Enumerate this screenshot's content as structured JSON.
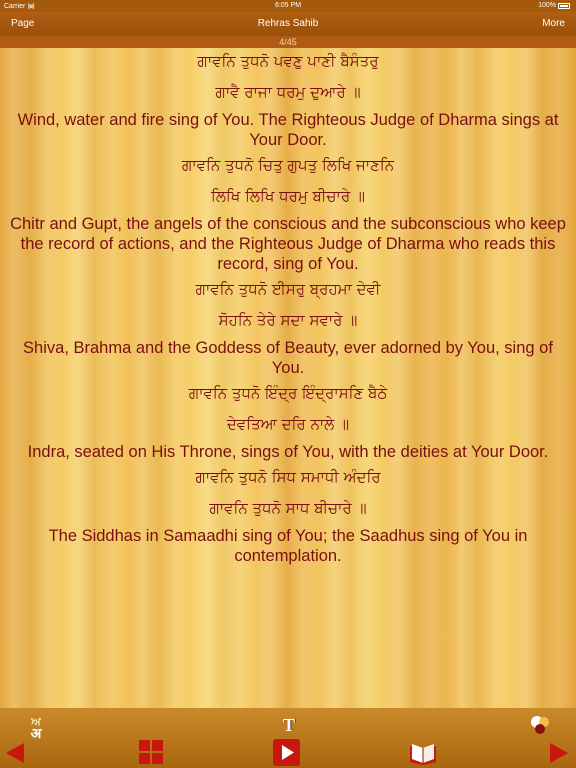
{
  "status": {
    "carrier": "Carrier",
    "time": "6:05 PM",
    "battery": "100%"
  },
  "nav": {
    "back_label": "Page",
    "title": "Rehras Sahib",
    "more_label": "More"
  },
  "page_indicator": "4/45",
  "verses": [
    {
      "line1": "ਗਾਵਨਿ ਤੁਧਨੋ ਪਵਣੁ ਪਾਣੀ ਬੈਸੰਤਰੁ",
      "line2": "ਗਾਵੈ ਰਾਜਾ ਧਰਮੁ ਦੁਆਰੇ ॥",
      "translation": "Wind, water and fire sing of You. The Righteous Judge of Dharma sings at Your Door."
    },
    {
      "line1": "ਗਾਵਨਿ ਤੁਧਨੋ ਚਿਤੁ ਗੁਪਤੁ ਲਿਖਿ ਜਾਣਨਿ",
      "line2": "ਲਿਖਿ ਲਿਖਿ ਧਰਮੁ ਬੀਚਾਰੇ ॥",
      "translation": "Chitr and Gupt, the angels of the conscious and the subconscious who keep the record of actions, and the Righteous Judge of Dharma who reads this record, sing of You."
    },
    {
      "line1": "ਗਾਵਨਿ ਤੁਧਨੋ ਈਸਰੁ ਬ੍ਰਹਮਾ ਦੇਵੀ",
      "line2": "ਸੋਹਨਿ ਤੇਰੇ ਸਦਾ ਸਵਾਰੇ ॥",
      "translation": "Shiva, Brahma and the Goddess of Beauty, ever adorned by You, sing of You."
    },
    {
      "line1": "ਗਾਵਨਿ ਤੁਧਨੋ ਇੰਦ੍ਰ ਇੰਦ੍ਰਾਸਣਿ ਬੈਠੇ",
      "line2": "ਦੇਵਤਿਆ ਦਰਿ ਨਾਲੇ ॥",
      "translation": "Indra, seated on His Throne, sings of You, with the deities at Your Door."
    },
    {
      "line1": "ਗਾਵਨਿ ਤੁਧਨੋ ਸਿਧ ਸਮਾਧੀ ਅੰਦਰਿ",
      "line2": "ਗਾਵਨਿ ਤੁਧਨੋ ਸਾਧ ਬੀਚਾਰੇ ॥",
      "translation": "The Siddhas in Samaadhi sing of You; the Saadhus sing of You in contemplation."
    }
  ],
  "toolbar": {
    "script_toggle_top": "ਅ",
    "script_toggle_bottom": "अ",
    "font_glyph": "T",
    "icons": {
      "prev": "left-arrow-icon",
      "grid": "grid-icon",
      "play": "play-icon",
      "book": "book-icon",
      "next": "right-arrow-icon",
      "color": "color-dots-icon"
    }
  },
  "colors": {
    "text": "#7a0f0f",
    "nav_bg": "#a45a0c",
    "toolbar_red": "#c8170e",
    "gold": "#f3c45a"
  }
}
